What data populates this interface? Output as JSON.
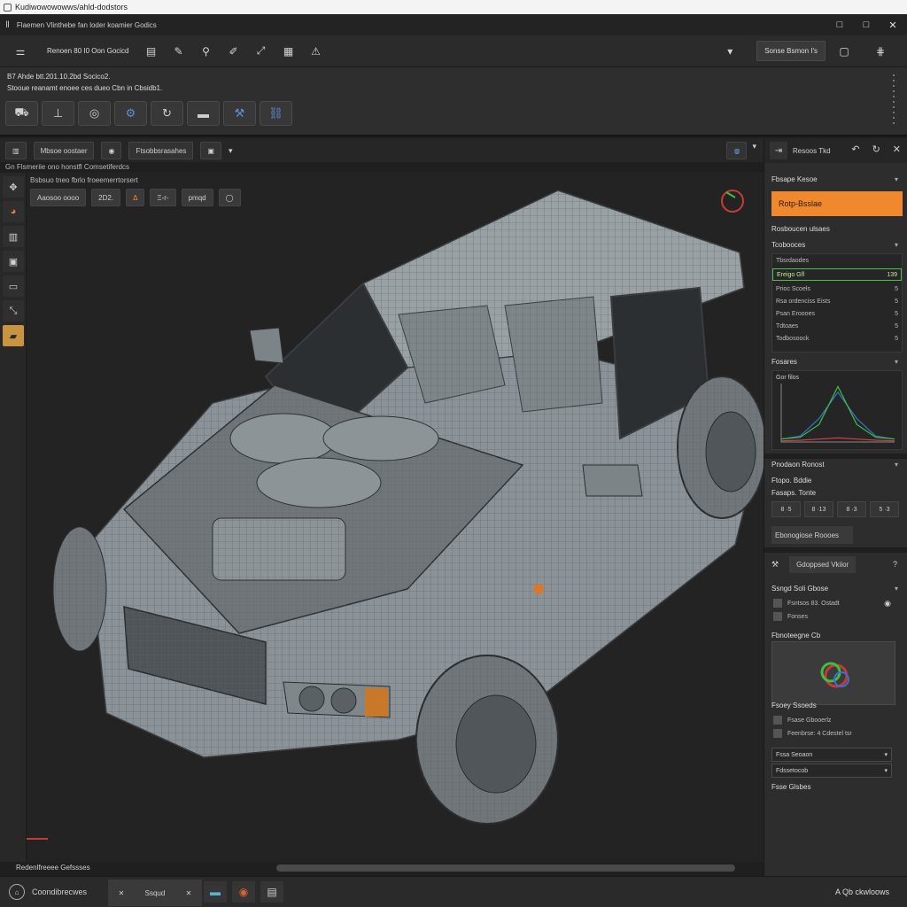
{
  "titlebar": {
    "title": "Kudiwowowowws/ahld-dodstors"
  },
  "menubar": {
    "menu_title": "Flaemen Vlinthebe fan loder koamier Godics",
    "controls": [
      "□",
      "□",
      "✕"
    ]
  },
  "toolbar": {
    "label": "Renoen 80 I0 Oon Gocicd",
    "right_button": "Sonse Bsmon I's"
  },
  "info": {
    "line1": "B7 Ahde btt.201.10.2bd Socico2.",
    "line2": "Stooue reanamt enoee ces dueo Cbn in Cbsidb1."
  },
  "viewbar": {
    "btn1": "Mbsoe oostaer",
    "btn3": "Ftsobbsrasahes",
    "status": "Gn Flsmeriie ono honstfl Comsetiferdcs"
  },
  "viewport": {
    "toolbar_caption": "Bsbsuo tneo fbrlo froeemerrtorsert",
    "tools": [
      "Aaosoo oooo",
      "2D2.",
      "Δ",
      "Ξ-r-",
      "pmqd",
      "◯"
    ]
  },
  "hscroll": {
    "label": "Redenlfreeee Gefssses"
  },
  "bottombar": {
    "left_label": "Coondibrecwes",
    "tab_label": "Ssqud",
    "right_label": "A  Qb ckwloows"
  },
  "rightpanel": {
    "head_label": "Resoos Tkd",
    "sec1_title": "Fbsape Kesoe",
    "orange_button": "Rotp-Bsslae",
    "sec2_title": "Rosboucen ulsaes",
    "list_title": "Tcobooces",
    "list": [
      {
        "label": "Tbsrdaodes",
        "val": ""
      },
      {
        "label": "Ereigo Gfl",
        "val": "139"
      },
      {
        "label": "Prioc Scoels",
        "val": "5"
      },
      {
        "label": "Rsa ordenciss Eists",
        "val": "5"
      },
      {
        "label": "Psan Eroooes",
        "val": "5"
      },
      {
        "label": "Tdtoaes",
        "val": "5"
      },
      {
        "label": "Todbosoock",
        "val": "5"
      }
    ],
    "chart_section": "Fosares",
    "chart_caption": "Gor filos",
    "sec3_title": "Pnodaon Ronost",
    "row_a": "Ftopo. Bddie",
    "row_b": "Fasaps. Tonte",
    "mini": [
      "8 ·5",
      "8 ·13",
      "8 ·3",
      "5 ·3"
    ],
    "gray_bar": "Ebonogiose Roooes",
    "section_btn": "Gdoppsed Vkiior",
    "sec4_title": "Ssngd Soli Gbose",
    "small_rows": [
      "Fsntsos 83. Ostadt",
      "Fonses"
    ],
    "preview_title": "Fbnoteegne Cb",
    "sec5_title": "Fsoey Ssoeds",
    "small_rows2": [
      "Fsase Gbooerlz",
      "Feenbrse: 4 Cdestel tsr"
    ],
    "select1": "Fssa Seoaon",
    "select2": "Fdssetocob",
    "footer": "Fsse Glsbes"
  },
  "chart_data": {
    "type": "line",
    "series": [
      {
        "name": "",
        "color": "#3b6fd0",
        "values": [
          0.05,
          0.1,
          0.4,
          0.85,
          0.4,
          0.1,
          0.05
        ]
      },
      {
        "name": "",
        "color": "#3fbf3f",
        "values": [
          0.05,
          0.08,
          0.3,
          0.95,
          0.3,
          0.08,
          0.05
        ]
      },
      {
        "name": "",
        "color": "#d04040",
        "values": [
          0.02,
          0.03,
          0.05,
          0.07,
          0.05,
          0.03,
          0.02
        ]
      }
    ]
  },
  "colors": {
    "accent": "#f0882d",
    "highlight": "#4bc24b"
  }
}
